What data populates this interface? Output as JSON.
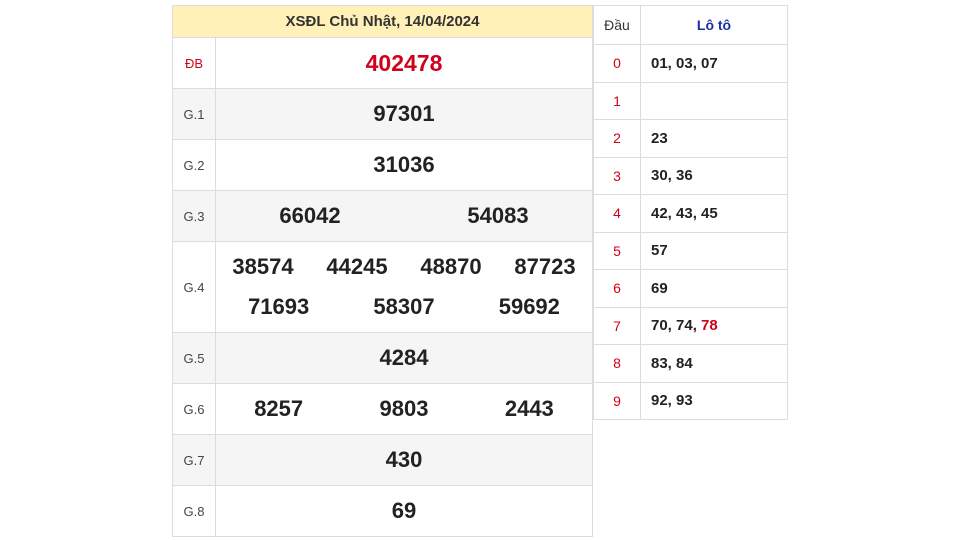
{
  "title": "XSĐL Chủ Nhật, 14/04/2024",
  "prizes": {
    "db": {
      "label": "ĐB",
      "numbers": [
        "402478"
      ]
    },
    "g1": {
      "label": "G.1",
      "numbers": [
        "97301"
      ]
    },
    "g2": {
      "label": "G.2",
      "numbers": [
        "31036"
      ]
    },
    "g3": {
      "label": "G.3",
      "numbers": [
        "66042",
        "54083"
      ]
    },
    "g4": {
      "label": "G.4",
      "numbers": [
        "38574",
        "44245",
        "48870",
        "87723",
        "71693",
        "58307",
        "59692"
      ]
    },
    "g5": {
      "label": "G.5",
      "numbers": [
        "4284"
      ]
    },
    "g6": {
      "label": "G.6",
      "numbers": [
        "8257",
        "9803",
        "2443"
      ]
    },
    "g7": {
      "label": "G.7",
      "numbers": [
        "430"
      ]
    },
    "g8": {
      "label": "G.8",
      "numbers": [
        "69"
      ]
    }
  },
  "loto": {
    "header_dau": "Đầu",
    "header_loto": "Lô tô",
    "rows": [
      {
        "dau": "0",
        "values": "01, 03, 07"
      },
      {
        "dau": "1",
        "values": ""
      },
      {
        "dau": "2",
        "values": "23"
      },
      {
        "dau": "3",
        "values": "30, 36"
      },
      {
        "dau": "4",
        "values": "42, 43, 45"
      },
      {
        "dau": "5",
        "values": "57"
      },
      {
        "dau": "6",
        "values": "69"
      },
      {
        "dau": "7",
        "values": "70, 74, ",
        "highlight": "78"
      },
      {
        "dau": "8",
        "values": "83, 84"
      },
      {
        "dau": "9",
        "values": "92, 93"
      }
    ]
  },
  "colors": {
    "special": "#d0021b",
    "title_bg": "#fff1b8",
    "loto_header": "#1a2ea8",
    "alt_row": "#f5f5f5"
  }
}
